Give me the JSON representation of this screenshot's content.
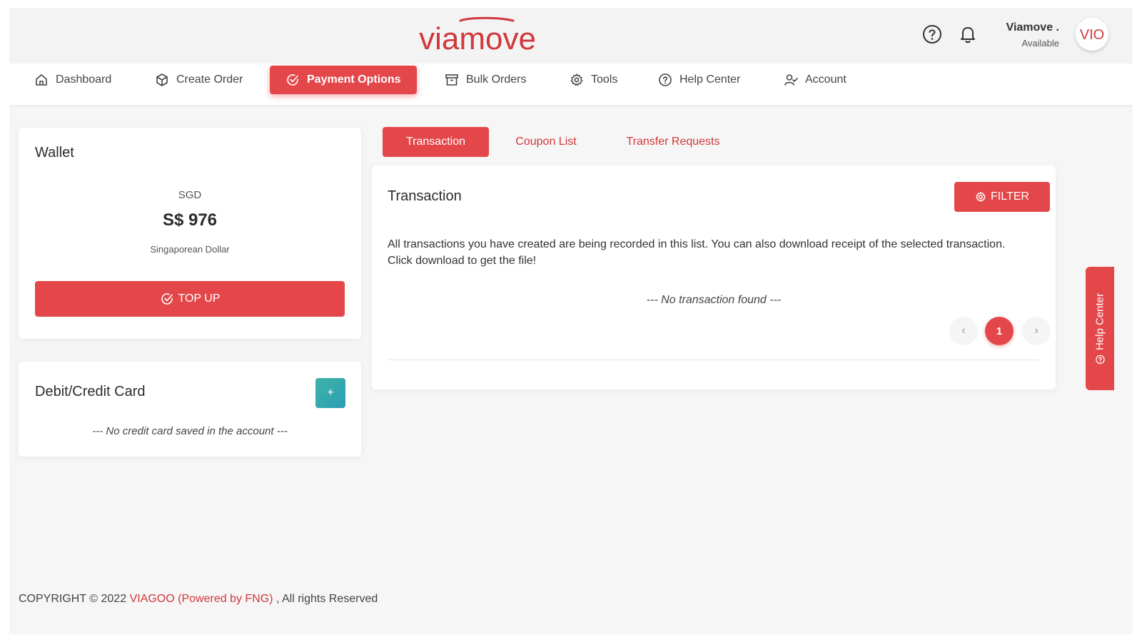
{
  "header": {
    "logo_text": "viamove",
    "user_name": "Viamove .",
    "user_status": "Available",
    "avatar_text": "VIO"
  },
  "nav": {
    "items": [
      {
        "label": "Dashboard",
        "icon": "home-icon"
      },
      {
        "label": "Create Order",
        "icon": "package-icon"
      },
      {
        "label": "Payment Options",
        "icon": "check-circle-icon",
        "active": true
      },
      {
        "label": "Bulk Orders",
        "icon": "archive-icon"
      },
      {
        "label": "Tools",
        "icon": "gear-icon"
      },
      {
        "label": "Help Center",
        "icon": "question-circle-icon"
      },
      {
        "label": "Account",
        "icon": "user-check-icon"
      }
    ]
  },
  "wallet": {
    "title": "Wallet",
    "currency_code": "SGD",
    "balance": "S$ 976",
    "currency_name": "Singaporean Dollar",
    "topup_label": "TOP UP"
  },
  "cards": {
    "title": "Debit/Credit Card",
    "add_label": "+",
    "empty_text": "--- No credit card saved in the account ---"
  },
  "tabs": [
    {
      "label": "Transaction",
      "active": true
    },
    {
      "label": "Coupon List",
      "active": false
    },
    {
      "label": "Transfer Requests",
      "active": false
    }
  ],
  "transaction": {
    "title": "Transaction",
    "filter_label": "FILTER",
    "description": "All transactions you have created are being recorded in this list. You can also download receipt of the selected transaction. Click download to get the file!",
    "empty_text": "--- No transaction found ---",
    "current_page": "1",
    "prev_symbol": "‹",
    "next_symbol": "›"
  },
  "help_tab": {
    "label": "Help Center"
  },
  "footer": {
    "prefix": "COPYRIGHT © 2022",
    "brand": "VIAGOO (Powered by FNG)",
    "suffix": ", All rights Reserved"
  },
  "colors": {
    "accent": "#e4474a",
    "teal": "#3aa9ac",
    "background": "#f6f6f6"
  }
}
